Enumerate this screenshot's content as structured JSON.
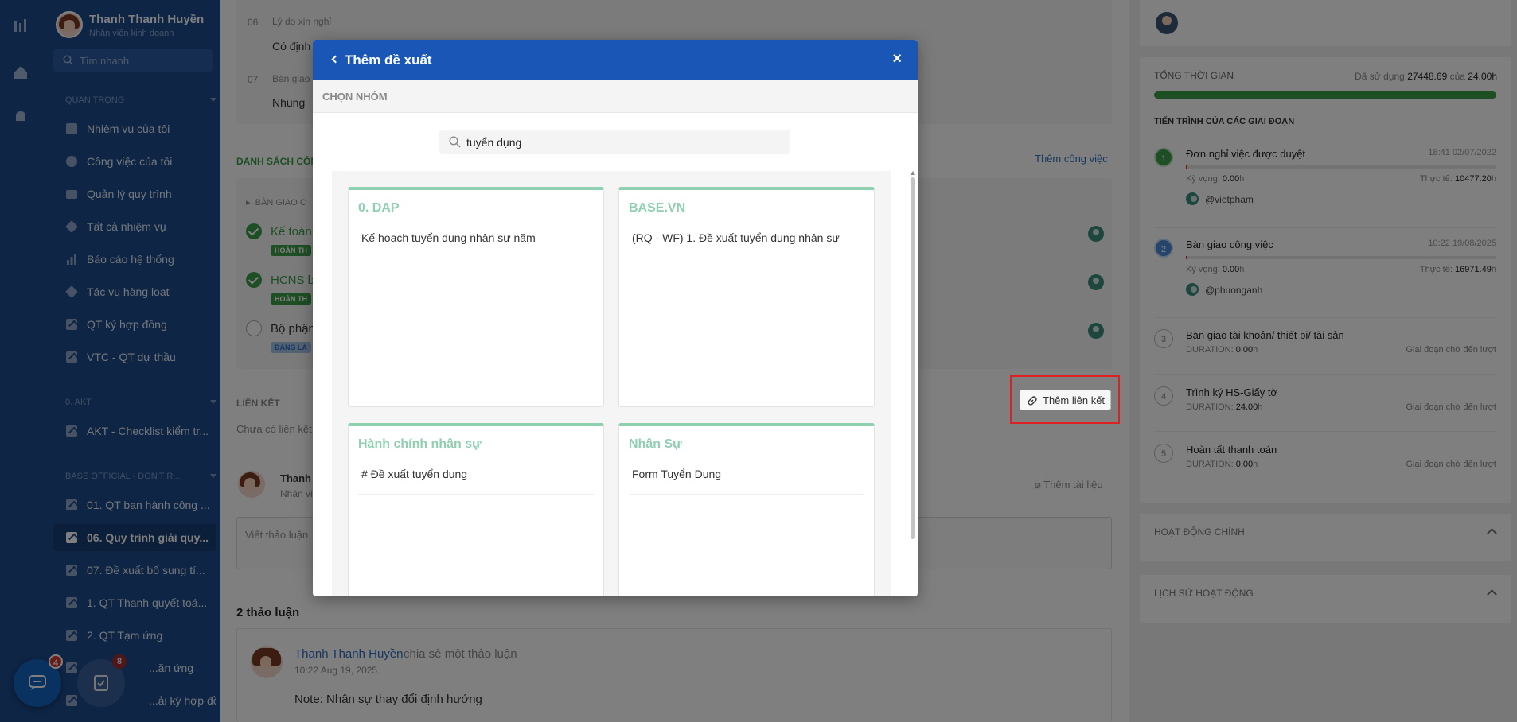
{
  "user": {
    "name": "Thanh Thanh Huyền",
    "role": "Nhân viên kinh doanh"
  },
  "sidebar": {
    "search_placeholder": "Tìm nhanh",
    "sections": [
      "QUAN TRỌNG",
      "0. AKT",
      "BASE OFFICIAL - DON'T R..."
    ],
    "items": [
      {
        "label": "Nhiệm vụ của tôi",
        "icon": "checkbox-icon"
      },
      {
        "label": "Công việc của tôi",
        "icon": "clock-icon"
      },
      {
        "label": "Quản lý quy trình",
        "icon": "folder-icon"
      },
      {
        "label": "Tất cả nhiệm vụ",
        "icon": "layers-icon"
      },
      {
        "label": "Báo cáo hệ thống",
        "icon": "bar-chart-icon"
      },
      {
        "label": "Tác vụ hàng loạt",
        "icon": "layers-icon"
      },
      {
        "label": "QT ký hợp đồng",
        "icon": "workflow-icon"
      },
      {
        "label": "VTC - QT dự thầu",
        "icon": "workflow-icon"
      }
    ],
    "akt_items": [
      {
        "label": "AKT - Checklist kiểm tr...",
        "icon": "workflow-icon"
      }
    ],
    "base_items": [
      {
        "label": "01. QT ban hành công ...",
        "icon": "workflow-icon"
      },
      {
        "label": "06. Quy trình giải quy...",
        "icon": "workflow-icon",
        "active": true
      },
      {
        "label": "07. Đề xuất bổ sung tí...",
        "icon": "workflow-icon"
      },
      {
        "label": "1. QT Thanh quyết toá...",
        "icon": "workflow-icon"
      },
      {
        "label": "2. QT Tạm ứng",
        "icon": "workflow-icon"
      },
      {
        "label": "...ăn ứng",
        "icon": "workflow-icon"
      },
      {
        "label": "...ải ký hợp đồng ...",
        "icon": "workflow-icon"
      }
    ],
    "fab_chat_badge": "4",
    "fab_task_badge": "8"
  },
  "main": {
    "fields": [
      {
        "num": "06",
        "label": "Lý do xin nghỉ",
        "value": "Có định"
      },
      {
        "num": "07",
        "label": "Bàn giao",
        "value": "Nhung"
      }
    ],
    "tasks_title": "DANH SÁCH CÔNG",
    "add_task": "Thêm công việc",
    "handover_title": "BÀN GIAO C",
    "tasks": [
      {
        "name": "Kế toán",
        "tag": "HOÀN TH",
        "status": "done"
      },
      {
        "name": "HCNS b",
        "tag": "HOÀN TH",
        "status": "done"
      },
      {
        "name": "Bộ phận",
        "tag": "ĐANG LÀ",
        "status": "doing"
      }
    ],
    "links_title": "LIÊN KẾT",
    "no_links": "Chưa có liên kết",
    "add_link": "Thêm liên kết",
    "comment_author": "Thanh",
    "comment_role": "Nhân vi",
    "add_doc": "Thêm tài liệu",
    "comment_placeholder": "Viết thảo luận",
    "discussion_count": "2 thảo luận",
    "post": {
      "author": "Thanh Thanh Huyền",
      "action": "chia sẻ một thảo luận",
      "time": "10:22 Aug 19, 2025",
      "note": "Note: Nhân sự thay đổi định hướng"
    }
  },
  "right": {
    "total_time": "TỔNG THỜI GIAN",
    "used_label": "Đã sử dụng",
    "used_value": "27448.69",
    "of_label": "của",
    "of_value": "24.00h",
    "progress_pct": 100,
    "stages_title": "TIẾN TRÌNH CỦA CÁC GIAI ĐOẠN",
    "stages": [
      {
        "n": "1",
        "title": "Đơn nghỉ việc được duyệt",
        "time": "18:41 02/07/2022",
        "expect_label": "Kỳ vọng:",
        "expect": "0.00",
        "actual_label": "Thực tế:",
        "actual": "10477.20",
        "user": "@vietpham",
        "state": "done"
      },
      {
        "n": "2",
        "title": "Bàn giao công việc",
        "time": "10:22 19/08/2025",
        "expect_label": "Kỳ vọng:",
        "expect": "0.00",
        "actual_label": "Thực tế:",
        "actual": "16971.49",
        "user": "@phuonganh",
        "state": "current"
      },
      {
        "n": "3",
        "title": "Bàn giao tài khoản/ thiết bị/ tài sản",
        "duration_label": "DURATION:",
        "duration": "0.00",
        "wait": "Giai đoạn chờ đến lượt",
        "state": "wait"
      },
      {
        "n": "4",
        "title": "Trình ký HS-Giấy tờ",
        "duration_label": "DURATION:",
        "duration": "24.00",
        "wait": "Giai đoạn chờ đến lượt",
        "state": "wait"
      },
      {
        "n": "5",
        "title": "Hoàn tất thanh toán",
        "duration_label": "DURATION:",
        "duration": "0.00",
        "wait": "Giai đoạn chờ đến lượt",
        "state": "wait"
      }
    ],
    "unit_h": "h",
    "main_activity": "HOẠT ĐỘNG CHÍNH",
    "history": "LỊCH SỬ HOẠT ĐỘNG"
  },
  "modal": {
    "title": "Thêm đề xuất",
    "group_header": "CHỌN NHÓM",
    "search_value": "tuyển dụng",
    "groups": [
      {
        "title": "0. DAP",
        "items": [
          "Kế hoạch tuyển dụng nhân sự năm"
        ]
      },
      {
        "title": "BASE.VN",
        "items": [
          "(RQ - WF) 1. Đề xuất tuyển dụng nhân sự"
        ]
      },
      {
        "title": "Hành chính nhân sự",
        "items": [
          "# Đề xuất tuyển dụng"
        ]
      },
      {
        "title": "Nhân Sự",
        "items": [
          "Form Tuyển Dụng"
        ]
      }
    ]
  },
  "colors": {
    "primary": "#1a56b5",
    "sidebar": "#1d4a8c",
    "group_accent": "#8fd0b0",
    "success": "#3a9d48",
    "highlight": "#e02020"
  }
}
